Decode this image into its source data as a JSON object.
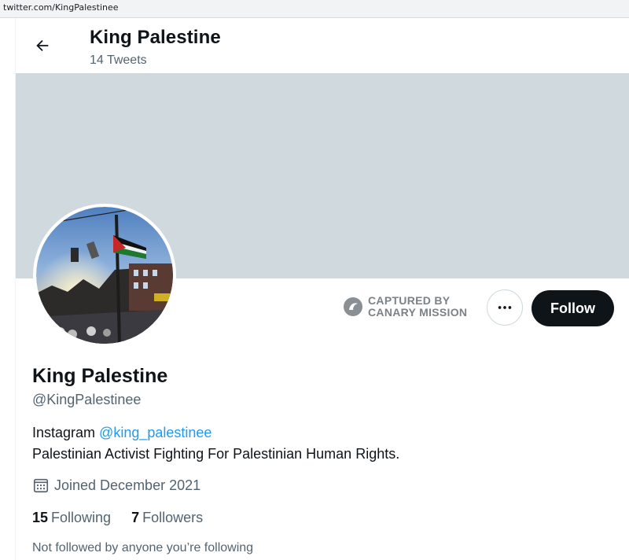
{
  "browser": {
    "url": "twitter.com/KingPalestinee"
  },
  "header": {
    "title": "King Palestine",
    "tweet_count": "14 Tweets"
  },
  "captured": {
    "line1": "CAPTURED BY",
    "line2": "CANARY MISSION"
  },
  "actions": {
    "follow_label": "Follow"
  },
  "profile": {
    "display_name": "King Palestine",
    "handle": "@KingPalestinee",
    "bio_prefix": "Instagram ",
    "bio_mention": "@king_palestinee",
    "bio_line2": "Palestinian Activist Fighting For Palestinian Human Rights.",
    "joined": "Joined December 2021",
    "following_count": "15",
    "following_label": "Following",
    "followers_count": "7",
    "followers_label": "Followers",
    "not_followed": "Not followed by anyone you’re following"
  },
  "icons": {
    "back": "arrow-left-icon",
    "more": "more-horizontal-icon",
    "calendar": "calendar-icon",
    "canary": "canary-mission-logo"
  },
  "colors": {
    "banner": "#cfd9de",
    "follow_bg": "#0f1419",
    "link": "#1d9bf0",
    "secondary_text": "#536471"
  }
}
